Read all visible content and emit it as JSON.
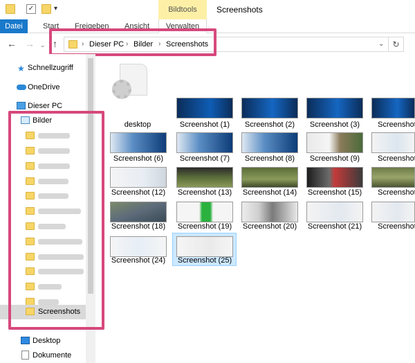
{
  "window": {
    "title": "Screenshots",
    "context_tab": "Bildtools"
  },
  "ribbon": {
    "tabs": [
      "Datei",
      "Start",
      "Freigeben",
      "Ansicht",
      "Verwalten"
    ]
  },
  "address": {
    "crumbs": [
      "Dieser PC",
      "Bilder",
      "Screenshots"
    ]
  },
  "nav": {
    "top": [
      {
        "label": "Schnellzugriff",
        "icon": "star-icon"
      },
      {
        "label": "OneDrive",
        "icon": "cloud-icon"
      },
      {
        "label": "Dieser PC",
        "icon": "computer-icon"
      },
      {
        "label": "Bilder",
        "icon": "pictures-folder-icon"
      }
    ],
    "subfolders_blurred_count": 11,
    "selected": "Screenshots",
    "bottom": [
      {
        "label": "Desktop",
        "icon": "desktop-icon"
      },
      {
        "label": "Dokumente",
        "icon": "documents-icon"
      }
    ]
  },
  "files": [
    "desktop",
    "Screenshot (1)",
    "Screenshot (2)",
    "Screenshot (3)",
    "Screenshot",
    "Screenshot (6)",
    "Screenshot (7)",
    "Screenshot (8)",
    "Screenshot (9)",
    "Screenshot",
    "Screenshot (12)",
    "Screenshot (13)",
    "Screenshot (14)",
    "Screenshot (15)",
    "Screenshot",
    "Screenshot (18)",
    "Screenshot (19)",
    "Screenshot (20)",
    "Screenshot (21)",
    "Screenshot",
    "Screenshot (24)",
    "Screenshot (25)"
  ],
  "selected_file": "Screenshot (25)",
  "colors": {
    "accent": "#1979ca",
    "highlight": "#d6497c",
    "selection": "#cce8ff",
    "context_tab": "#fdf0a6"
  }
}
